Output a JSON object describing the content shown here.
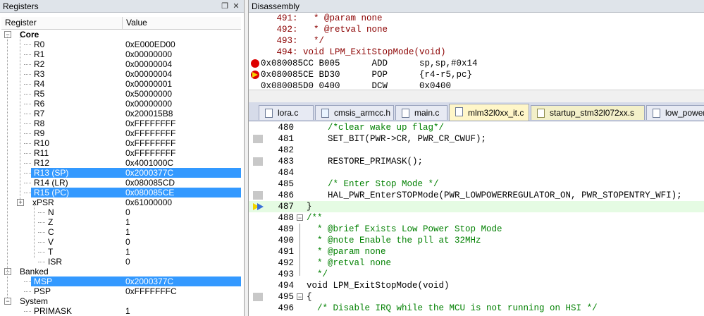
{
  "registers_panel": {
    "title": "Registers",
    "pin_glyph": "❒",
    "close_glyph": "✕",
    "col_register": "Register",
    "col_value": "Value",
    "rows": [
      {
        "name": "Core",
        "value": "",
        "level": 0,
        "group": true,
        "expander": "−"
      },
      {
        "name": "R0",
        "value": "0xE000ED00",
        "level": 2
      },
      {
        "name": "R1",
        "value": "0x00000000",
        "level": 2
      },
      {
        "name": "R2",
        "value": "0x00000004",
        "level": 2
      },
      {
        "name": "R3",
        "value": "0x00000004",
        "level": 2
      },
      {
        "name": "R4",
        "value": "0x00000001",
        "level": 2
      },
      {
        "name": "R5",
        "value": "0x50000000",
        "level": 2
      },
      {
        "name": "R6",
        "value": "0x00000000",
        "level": 2
      },
      {
        "name": "R7",
        "value": "0x200015B8",
        "level": 2
      },
      {
        "name": "R8",
        "value": "0xFFFFFFFF",
        "level": 2
      },
      {
        "name": "R9",
        "value": "0xFFFFFFFF",
        "level": 2
      },
      {
        "name": "R10",
        "value": "0xFFFFFFFF",
        "level": 2
      },
      {
        "name": "R11",
        "value": "0xFFFFFFFF",
        "level": 2
      },
      {
        "name": "R12",
        "value": "0x4001000C",
        "level": 2
      },
      {
        "name": "R13 (SP)",
        "value": "0x2000377C",
        "level": 2,
        "selected": true
      },
      {
        "name": "R14 (LR)",
        "value": "0x080085CD",
        "level": 2
      },
      {
        "name": "R15 (PC)",
        "value": "0x080085CE",
        "level": 2,
        "selected": true
      },
      {
        "name": "xPSR",
        "value": "0x61000000",
        "level": 1,
        "expander": "+"
      },
      {
        "name": "N",
        "value": "0",
        "level": 3
      },
      {
        "name": "Z",
        "value": "1",
        "level": 3
      },
      {
        "name": "C",
        "value": "1",
        "level": 3
      },
      {
        "name": "V",
        "value": "0",
        "level": 3
      },
      {
        "name": "T",
        "value": "1",
        "level": 3
      },
      {
        "name": "ISR",
        "value": "0",
        "level": 3
      },
      {
        "name": "Banked",
        "value": "",
        "level": 0,
        "expander": "−"
      },
      {
        "name": "MSP",
        "value": "0x2000377C",
        "level": 2,
        "selected": true
      },
      {
        "name": "PSP",
        "value": "0xFFFFFFFC",
        "level": 2
      },
      {
        "name": "System",
        "value": "",
        "level": 0,
        "expander": "−"
      },
      {
        "name": "PRIMASK",
        "value": "1",
        "level": 2
      }
    ]
  },
  "disassembly_panel": {
    "title": "Disassembly",
    "lines": [
      {
        "text": "   491:   * @param none",
        "kind": "src"
      },
      {
        "text": "   492:   * @retval none",
        "kind": "src"
      },
      {
        "text": "   493:   */",
        "kind": "src"
      },
      {
        "text": "   494: void LPM_ExitStopMode(void)",
        "kind": "src"
      },
      {
        "text": "0x080085CC B005      ADD      sp,sp,#0x14",
        "kind": "asm",
        "marker": "breakpoint"
      },
      {
        "text": "0x080085CE BD30      POP      {r4-r5,pc}",
        "kind": "asm",
        "marker": "current"
      },
      {
        "text": "0x080085D0 0400      DCW      0x0400",
        "kind": "asm"
      }
    ]
  },
  "editor": {
    "tabs": [
      {
        "label": "lora.c",
        "kind": "c"
      },
      {
        "label": "cmsis_armcc.h",
        "kind": "h"
      },
      {
        "label": "main.c",
        "kind": "c"
      },
      {
        "label": "mlm32l0xx_it.c",
        "kind": "c",
        "active": true
      },
      {
        "label": "startup_stm32l072xx.s",
        "kind": "s"
      },
      {
        "label": "low_power_manager.c",
        "kind": "c"
      }
    ],
    "lines": [
      {
        "num": "480",
        "text": "    /*clear wake up flag*/",
        "kind": "cmt"
      },
      {
        "num": "481",
        "text": "    SET_BIT(PWR->CR, PWR_CR_CWUF);",
        "kind": "code",
        "mark": true
      },
      {
        "num": "482",
        "text": "",
        "kind": "code"
      },
      {
        "num": "483",
        "text": "    RESTORE_PRIMASK();",
        "kind": "code",
        "mark": true
      },
      {
        "num": "484",
        "text": "",
        "kind": "code"
      },
      {
        "num": "485",
        "text": "    /* Enter Stop Mode */",
        "kind": "cmt"
      },
      {
        "num": "486",
        "text": "    HAL_PWR_EnterSTOPMode(PWR_LOWPOWERREGULATOR_ON, PWR_STOPENTRY_WFI);",
        "kind": "code",
        "mark": true
      },
      {
        "num": "487",
        "text": "}",
        "kind": "code",
        "current": true
      },
      {
        "num": "488",
        "text": "/**",
        "kind": "cmt",
        "fold": "−"
      },
      {
        "num": "489",
        "text": "  * @brief Exists Low Power Stop Mode",
        "kind": "cmt"
      },
      {
        "num": "490",
        "text": "  * @note Enable the pll at 32MHz",
        "kind": "cmt"
      },
      {
        "num": "491",
        "text": "  * @param none",
        "kind": "cmt"
      },
      {
        "num": "492",
        "text": "  * @retval none",
        "kind": "cmt"
      },
      {
        "num": "493",
        "text": "  */",
        "kind": "cmt"
      },
      {
        "num": "494",
        "text": "void LPM_ExitStopMode(void)",
        "kind": "code"
      },
      {
        "num": "495",
        "text": "{",
        "kind": "code",
        "fold": "−",
        "mark": true
      },
      {
        "num": "496",
        "text": "  /* Disable IRQ while the MCU is not running on HSI */",
        "kind": "cmt"
      }
    ]
  },
  "colors": {
    "selection": "#3399ff",
    "comment": "#008000",
    "source_line": "#8b0000",
    "breakpoint": "#dd0000",
    "current_arrow": "#f2d400",
    "current_line_bg": "#e5fbe3"
  }
}
